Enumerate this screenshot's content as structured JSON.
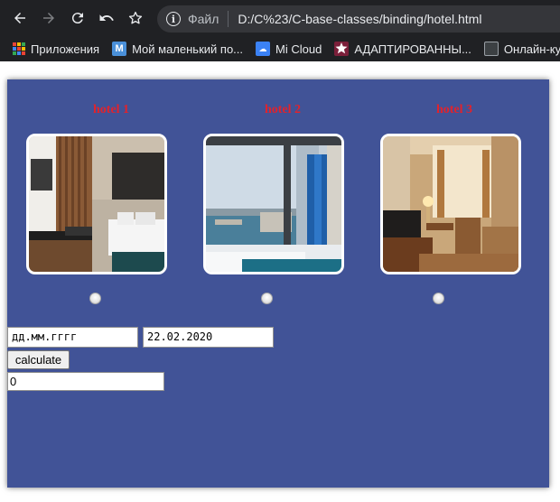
{
  "browser": {
    "omnibox": {
      "scheme_label": "Файл",
      "url": "D:/C%23/C-base-classes/binding/hotel.html"
    },
    "bookmarks": [
      {
        "label": "Приложения",
        "icon": "apps-grid-icon"
      },
      {
        "label": "Мой маленький по...",
        "icon": "m-logo-icon"
      },
      {
        "label": "Mi Cloud",
        "icon": "cloud-icon"
      },
      {
        "label": "АДАПТИРОВАННЫ...",
        "icon": "star-logo-icon"
      },
      {
        "label": "Онлайн-курсы",
        "icon": "monitor-icon"
      }
    ]
  },
  "hotels": [
    {
      "title": "hotel 1",
      "photo": "hotel-room-photo-1"
    },
    {
      "title": "hotel 2",
      "photo": "hotel-room-sea-view-photo"
    },
    {
      "title": "hotel 3",
      "photo": "hotel-room-photo-3"
    }
  ],
  "form": {
    "date_from_placeholder": "дд.мм.гггг",
    "date_to_value": "22.02.2020",
    "calculate_label": "calculate",
    "result_value": "0"
  },
  "colors": {
    "panel_bg": "#415397",
    "hotel_title": "#e0232d",
    "chrome_bg": "#202124"
  }
}
